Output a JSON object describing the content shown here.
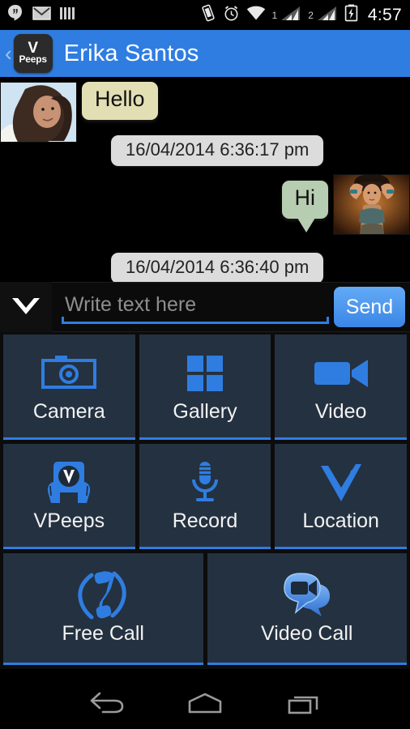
{
  "status_bar": {
    "left_icons": [
      "hangouts-icon",
      "gmail-icon",
      "bars-icon"
    ],
    "right_icons": [
      "vibrate-icon",
      "alarm-icon",
      "wifi-icon",
      "signal-icon",
      "signal-icon",
      "battery-charging-icon"
    ],
    "sim1_label": "1",
    "sim2_label": "2",
    "clock": "4:57"
  },
  "title_bar": {
    "back_label": "‹",
    "logo_v": "V",
    "logo_peeps": "Peeps",
    "contact_name": "Erika Santos",
    "background_color": "#2f7de1"
  },
  "chat": {
    "messages": [
      {
        "id": "msg-hello",
        "text": "Hello",
        "side": "left",
        "bubble_color": "#e3dfb4",
        "avatar": "contact-avatar"
      },
      {
        "id": "stamp-1",
        "text": "16/04/2014 6:36:17 pm",
        "side": "center",
        "bubble_color": "#dcdcdc"
      },
      {
        "id": "msg-hi",
        "text": "Hi",
        "side": "right",
        "bubble_color": "#b7cdb1",
        "avatar": "self-avatar"
      },
      {
        "id": "stamp-2",
        "text": "16/04/2014 6:36:40 pm",
        "side": "center",
        "bubble_color": "#dcdcdc"
      }
    ]
  },
  "input_bar": {
    "expand_icon": "chevron-down-icon",
    "placeholder": "Write text here",
    "value": "",
    "send_label": "Send",
    "send_color": "#3a86e6",
    "underline_color": "#2f7de1"
  },
  "attachments": {
    "tile_background": "#243140",
    "accent_color": "#2f7de1",
    "rows": [
      [
        {
          "label": "Camera",
          "icon": "camera-icon"
        },
        {
          "label": "Gallery",
          "icon": "gallery-grid-icon"
        },
        {
          "label": "Video",
          "icon": "video-camera-icon"
        }
      ],
      [
        {
          "label": "VPeeps",
          "icon": "vpeeps-hands-icon"
        },
        {
          "label": "Record",
          "icon": "microphone-icon"
        },
        {
          "label": "Location",
          "icon": "location-pin-icon"
        }
      ],
      [
        {
          "label": "Free Call",
          "icon": "phone-handset-icon"
        },
        {
          "label": "Video Call",
          "icon": "video-chat-bubbles-icon"
        }
      ]
    ]
  },
  "nav_bar": {
    "buttons": [
      {
        "name": "back",
        "icon": "back-arrow-icon"
      },
      {
        "name": "home",
        "icon": "home-icon"
      },
      {
        "name": "recents",
        "icon": "recents-icon"
      }
    ]
  }
}
